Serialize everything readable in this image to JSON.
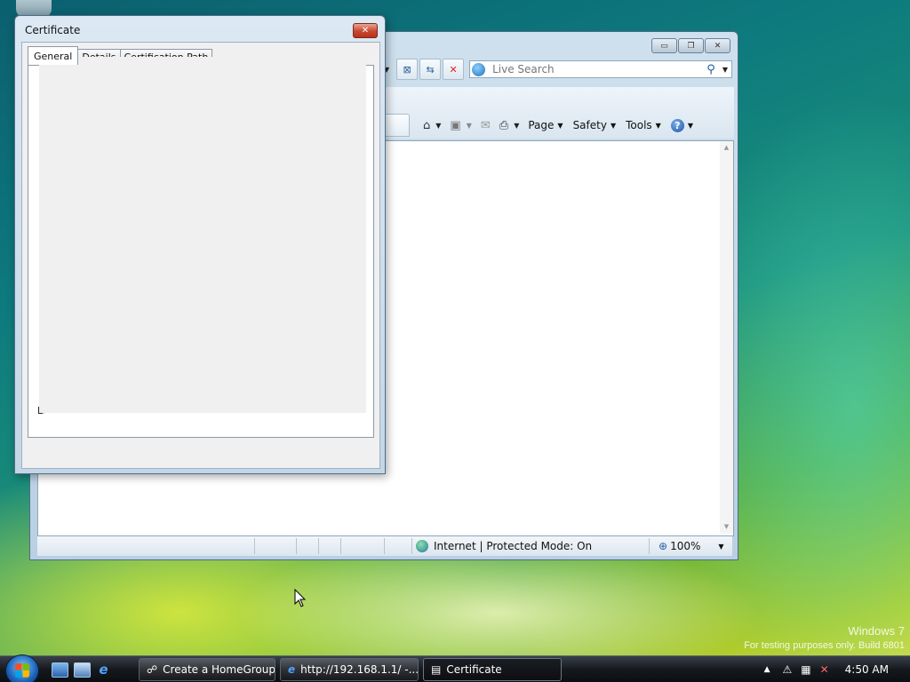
{
  "desktop": {
    "watermark_title": "Windows 7",
    "watermark_build": "For testing purposes only. Build 6801"
  },
  "ie_window": {
    "controls": {
      "minimize": "▭",
      "restore": "❐",
      "close": "✕"
    },
    "search": {
      "placeholder": "Live Search",
      "go_icon": "search-icon"
    },
    "command_bar": {
      "page_label": "Page",
      "safety_label": "Safety",
      "tools_label": "Tools",
      "help_label": "?"
    },
    "status": {
      "zone": "Internet | Protected Mode: On",
      "zoom": "100%"
    }
  },
  "certificate_dialog": {
    "title": "Certificate",
    "tabs": [
      {
        "label": "General",
        "active": true
      },
      {
        "label": "Details",
        "active": false
      },
      {
        "label": "Certification Path",
        "active": false
      }
    ],
    "learn_more_stub": "Le"
  },
  "taskbar": {
    "buttons": [
      {
        "label": "Create a HomeGroup"
      },
      {
        "label": "http://192.168.1.1/ -..."
      },
      {
        "label": "Certificate"
      }
    ],
    "clock": "4:50 AM"
  }
}
